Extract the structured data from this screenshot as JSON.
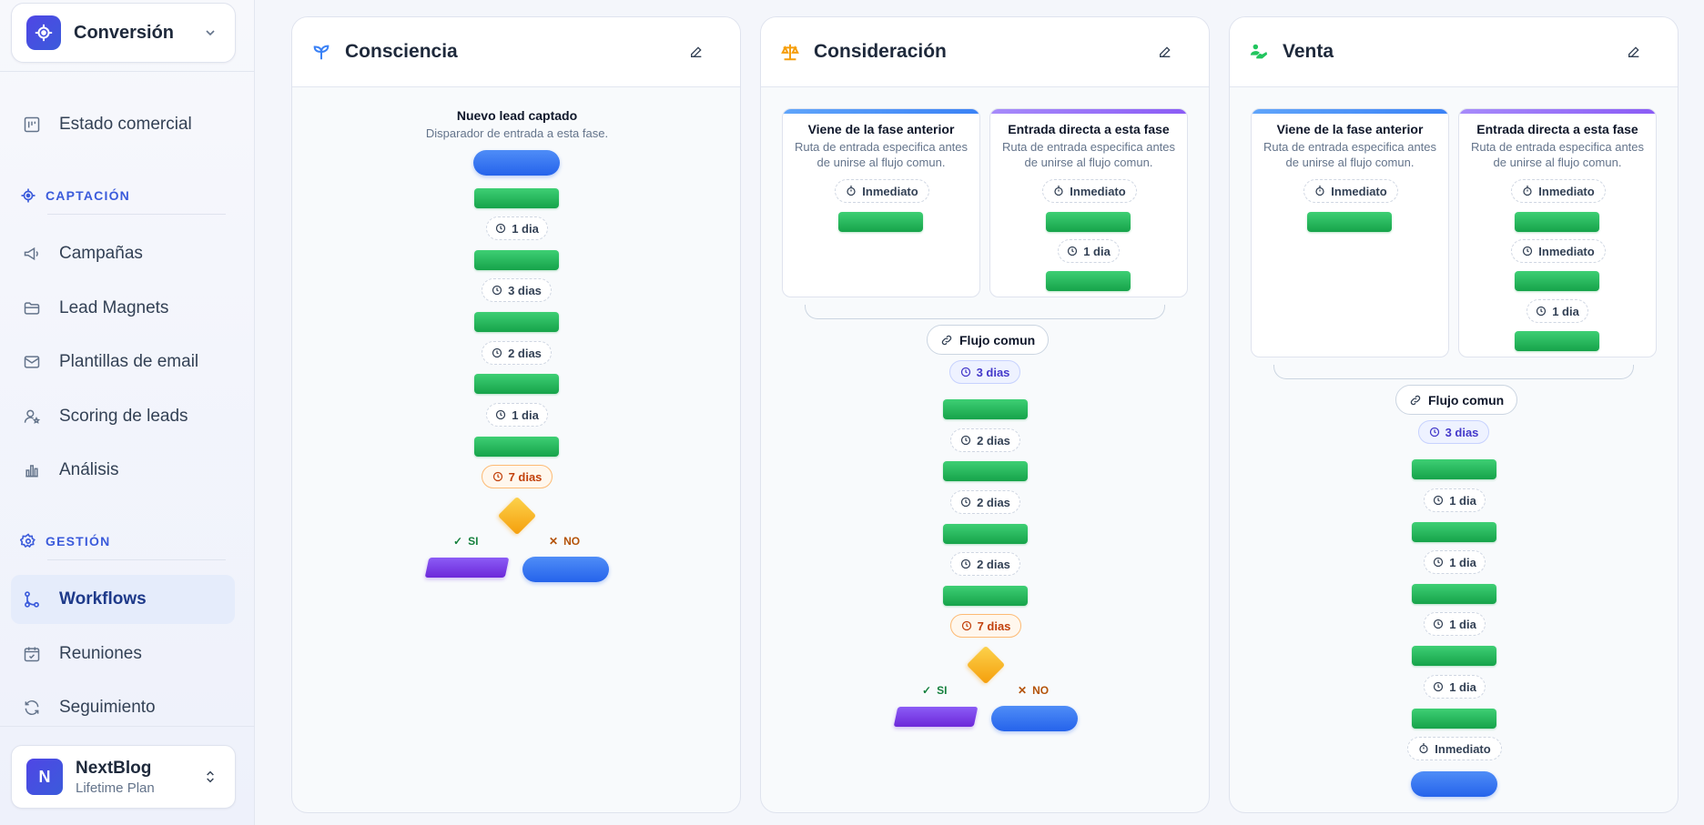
{
  "workspace": {
    "name": "Conversión"
  },
  "nav": {
    "top": [
      {
        "label": "Estado comercial"
      }
    ],
    "sections": [
      {
        "label": "CAPTACIÓN",
        "items": [
          {
            "label": "Campañas"
          },
          {
            "label": "Lead Magnets"
          },
          {
            "label": "Plantillas de email"
          },
          {
            "label": "Scoring de leads"
          },
          {
            "label": "Análisis"
          }
        ]
      },
      {
        "label": "GESTIÓN",
        "items": [
          {
            "label": "Workflows"
          },
          {
            "label": "Reuniones"
          },
          {
            "label": "Seguimiento"
          }
        ]
      }
    ]
  },
  "account": {
    "initial": "N",
    "name": "NextBlog",
    "plan": "Lifetime Plan"
  },
  "stages": [
    {
      "title": "Consciencia",
      "trigger": {
        "title": "Nuevo lead captado",
        "subtitle": "Disparador de entrada a esta fase."
      },
      "delays": [
        "1 dia",
        "3 dias",
        "2 dias",
        "1 dia",
        "7 dias"
      ],
      "branches": {
        "yes": "SI",
        "no": "NO"
      }
    },
    {
      "title": "Consideración",
      "entries": [
        {
          "title": "Viene de la fase anterior",
          "subtitle": "Ruta de entrada especifica antes de unirse al flujo comun.",
          "delays": [
            "Inmediato"
          ]
        },
        {
          "title": "Entrada directa a esta fase",
          "subtitle": "Ruta de entrada especifica antes de unirse al flujo comun.",
          "delays": [
            "Inmediato",
            "1 dia"
          ]
        }
      ],
      "common_flow": "Flujo comun",
      "delays": [
        "3 dias",
        "2 dias",
        "2 dias",
        "2 dias",
        "7 dias"
      ],
      "branches": {
        "yes": "SI",
        "no": "NO"
      }
    },
    {
      "title": "Venta",
      "entries": [
        {
          "title": "Viene de la fase anterior",
          "subtitle": "Ruta de entrada especifica antes de unirse al flujo comun.",
          "delays": [
            "Inmediato"
          ]
        },
        {
          "title": "Entrada directa a esta fase",
          "subtitle": "Ruta de entrada especifica antes de unirse al flujo comun.",
          "delays": [
            "Inmediato",
            "Inmediato",
            "1 dia"
          ]
        }
      ],
      "common_flow": "Flujo comun",
      "delays": [
        "3 dias",
        "1 dia",
        "1 dia",
        "1 dia",
        "1 dia",
        "Inmediato"
      ]
    }
  ],
  "colors": {
    "accent": "#3b5bdb",
    "step": "#22c55e",
    "action": "#2563eb",
    "condition": "#f59e0b",
    "branch_action": "#7c3aed"
  }
}
